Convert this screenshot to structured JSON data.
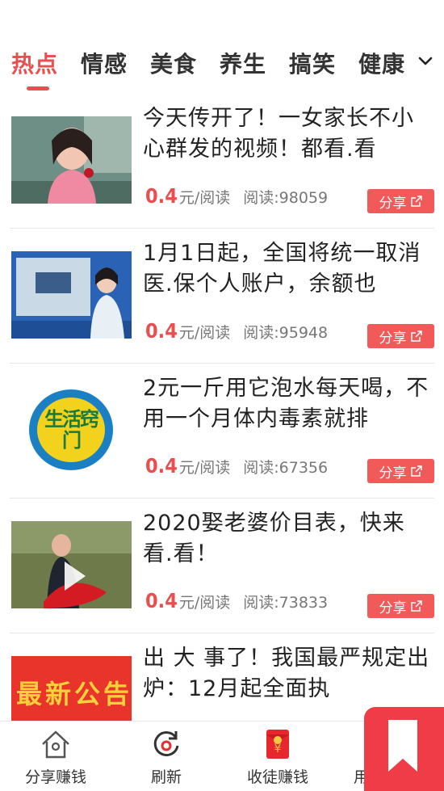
{
  "tabs": [
    {
      "label": "热点",
      "active": true
    },
    {
      "label": "情感",
      "active": false
    },
    {
      "label": "美食",
      "active": false
    },
    {
      "label": "养生",
      "active": false
    },
    {
      "label": "搞笑",
      "active": false
    },
    {
      "label": "健康",
      "active": false
    }
  ],
  "tabs_more_icon": "chevron-down-icon",
  "articles": [
    {
      "title": "今天传开了！一女家长不小心群发的视频！都看.看",
      "price": "0.4",
      "unit": "元/阅读",
      "reads": "阅读:98059",
      "share": "分享"
    },
    {
      "title": "1月1日起，全国将统一取消医.保个人账户，余额也",
      "price": "0.4",
      "unit": "元/阅读",
      "reads": "阅读:95948",
      "share": "分享"
    },
    {
      "title": "2元一斤用它泡水每天喝，不用一个月体内毒素就排",
      "price": "0.4",
      "unit": "元/阅读",
      "reads": "阅读:67356",
      "share": "分享",
      "thumb_text": "生活窍门"
    },
    {
      "title": "2020娶老婆价目表，快来看.看！",
      "price": "0.4",
      "unit": "元/阅读",
      "reads": "阅读:73833",
      "share": "分享"
    },
    {
      "title": "出 大 事了！我国最严规定出炉：12月起全面执",
      "thumb_text": "最新公告"
    }
  ],
  "bottom_nav": [
    {
      "label": "分享赚钱",
      "icon": "home-icon"
    },
    {
      "label": "刷新",
      "icon": "refresh-icon"
    },
    {
      "label": "收徒赚钱",
      "icon": "red-envelope-icon",
      "icon_text": "¥"
    },
    {
      "label": "用",
      "icon": "user-icon"
    }
  ],
  "colors": {
    "accent": "#e94f4f",
    "share_bg": "#f25a5a",
    "float_bg": "#ef3c46"
  }
}
